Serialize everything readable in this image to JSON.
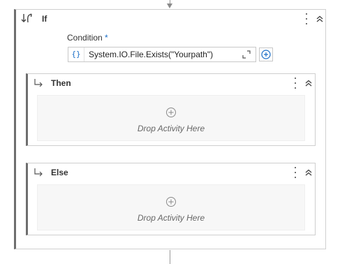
{
  "if_activity": {
    "title": "If",
    "icon": "if-branch-icon",
    "condition_label": "Condition",
    "condition_required_marker": "*",
    "condition_value": "System.IO.File.Exists(\"Yourpath\")",
    "condition_type_glyph": "{}"
  },
  "then_branch": {
    "title": "Then",
    "drop_placeholder": "Drop Activity Here"
  },
  "else_branch": {
    "title": "Else",
    "drop_placeholder": "Drop Activity Here"
  },
  "colors": {
    "accent": "#1a6ec7",
    "border": "#d0d0d0",
    "rail": "#6e6e6e",
    "drop_bg": "#f7f7f7"
  }
}
